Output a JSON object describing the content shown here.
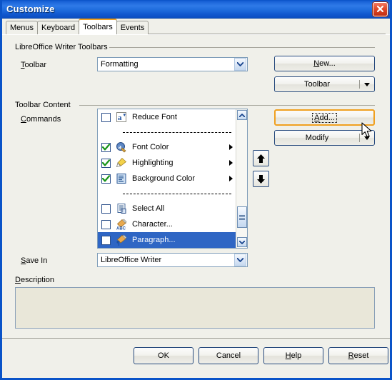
{
  "window": {
    "title": "Customize",
    "close_label": "Close"
  },
  "tabs": [
    {
      "label": "Menus",
      "active": false
    },
    {
      "label": "Keyboard",
      "active": false
    },
    {
      "label": "Toolbars",
      "active": true
    },
    {
      "label": "Events",
      "active": false
    }
  ],
  "toolbars_group": {
    "legend": "LibreOffice Writer Toolbars",
    "toolbar_label": "Toolbar",
    "toolbar_label_accel": "T",
    "toolbar_value": "Formatting",
    "new_button": "New...",
    "new_button_accel": "N",
    "toolbar_button": "Toolbar"
  },
  "content_group": {
    "legend": "Toolbar Content",
    "commands_label": "Commands",
    "commands_label_accel": "C",
    "add_button": "Add...",
    "add_button_accel": "A",
    "modify_button": "Modify"
  },
  "commands": [
    {
      "type": "item",
      "checked": false,
      "label": "Reduce Font",
      "icon": "reduce-font-icon",
      "submenu": false,
      "selected": false
    },
    {
      "type": "separator"
    },
    {
      "type": "item",
      "checked": true,
      "label": "Font Color",
      "icon": "font-color-icon",
      "submenu": true,
      "selected": false
    },
    {
      "type": "item",
      "checked": true,
      "label": "Highlighting",
      "icon": "highlighting-icon",
      "submenu": true,
      "selected": false
    },
    {
      "type": "item",
      "checked": true,
      "label": "Background Color",
      "icon": "background-color-icon",
      "submenu": true,
      "selected": false
    },
    {
      "type": "separator"
    },
    {
      "type": "item",
      "checked": false,
      "label": "Select All",
      "icon": "select-all-icon",
      "submenu": false,
      "selected": false
    },
    {
      "type": "item",
      "checked": false,
      "label": "Character...",
      "icon": "character-icon",
      "submenu": false,
      "selected": false
    },
    {
      "type": "item",
      "checked": false,
      "label": "Paragraph...",
      "icon": "paragraph-icon",
      "submenu": false,
      "selected": true
    }
  ],
  "save_in": {
    "label": "Save In",
    "label_accel": "S",
    "value": "LibreOffice Writer"
  },
  "description": {
    "label": "Description",
    "label_accel": "D",
    "text": ""
  },
  "footer": {
    "ok": "OK",
    "cancel": "Cancel",
    "help": "Help",
    "help_accel": "H",
    "reset": "Reset",
    "reset_accel": "R"
  },
  "colors": {
    "title_bar": "#1b64d8",
    "active_tab_accent": "#f0a020",
    "selection": "#2f66c4",
    "dialog_face": "#f0f0ea",
    "field_border": "#7f9db9",
    "description_bg": "#e9e7d9"
  }
}
